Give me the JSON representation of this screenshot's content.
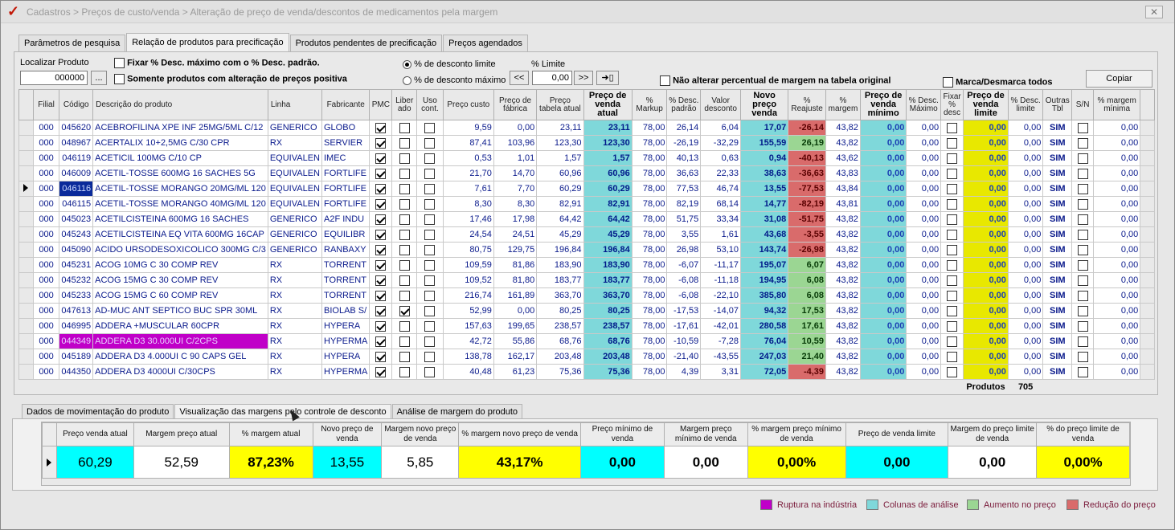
{
  "window": {
    "title": "Cadastros > Preços de custo/venda > Alteração de preço de venda/descontos de medicamentos pela margem",
    "close_label": "✕"
  },
  "tabs": [
    {
      "label": "Parâmetros de pesquisa"
    },
    {
      "label": "Relação de produtos para precificação"
    },
    {
      "label": "Produtos pendentes de precificação"
    },
    {
      "label": "Preços agendados"
    }
  ],
  "search": {
    "label": "Localizar Produto",
    "value": "000000",
    "browse_label": "...",
    "fix_desc_label": "Fixar % Desc. máximo com o % Desc. padrão.",
    "only_positive_label": "Somente produtos com alteração de preços positiva",
    "radio_limite_label": "% de desconto limite",
    "radio_maximo_label": "% de desconto máximo",
    "limit_label": "% Limite",
    "limit_value": "0,00",
    "prev_label": "<<",
    "next_label": ">>",
    "apply_label": "➜▯",
    "no_alter_label": "Não alterar percentual de margem na tabela original",
    "mark_all_label": "Marca/Desmarca todos",
    "copy_label": "Copiar"
  },
  "grid": {
    "headers": [
      "Filial",
      "Código",
      "Descrição do produto",
      "Linha",
      "Fabricante",
      "PMC",
      "Liber ado",
      "Uso cont.",
      "Preço custo",
      "Preço de fábrica",
      "Preço tabela atual",
      "Preço de venda atual",
      "% Markup",
      "% Desc. padrão",
      "Valor desconto",
      "Novo preço venda",
      "% Reajuste",
      "% margem",
      "Preço de venda mínimo",
      "% Desc. Máximo",
      "Fixar % desc",
      "Preço de venda limite",
      "% Desc. limite",
      "Outras Tbl",
      "S/N",
      "% margem mínima"
    ],
    "rows": [
      {
        "filial": "000",
        "codigo": "045620",
        "desc": "ACEBROFILINA XPE INF 25MG/5ML C/12",
        "linha": "GENERICO",
        "fab": "GLOBO",
        "pmc": true,
        "lib": false,
        "uso": false,
        "custo": "9,59",
        "fabrica": "0,00",
        "tabela": "23,11",
        "venda": "23,11",
        "markup": "78,00",
        "descp": "26,14",
        "valdesc": "6,04",
        "novo": "17,07",
        "reaj": "-26,14",
        "reajc": "red",
        "marg": "43,82",
        "minimo": "0,00",
        "descmax": "0,00",
        "fixar": false,
        "limite": "0,00",
        "desclim": "0,00",
        "outras": "SIM",
        "sn": false,
        "margmin": "0,00"
      },
      {
        "filial": "000",
        "codigo": "048967",
        "desc": "ACERTALIX 10+2,5MG C/30 CPR",
        "linha": "RX",
        "fab": "SERVIER",
        "pmc": true,
        "lib": false,
        "uso": false,
        "custo": "87,41",
        "fabrica": "103,96",
        "tabela": "123,30",
        "venda": "123,30",
        "markup": "78,00",
        "descp": "-26,19",
        "valdesc": "-32,29",
        "novo": "155,59",
        "reaj": "26,19",
        "reajc": "green",
        "marg": "43,82",
        "minimo": "0,00",
        "descmax": "0,00",
        "fixar": false,
        "limite": "0,00",
        "desclim": "0,00",
        "outras": "SIM",
        "sn": false,
        "margmin": "0,00"
      },
      {
        "filial": "000",
        "codigo": "046119",
        "desc": "ACETICIL 100MG C/10 CP",
        "linha": "EQUIVALEN",
        "fab": "IMEC",
        "pmc": true,
        "lib": false,
        "uso": false,
        "custo": "0,53",
        "fabrica": "1,01",
        "tabela": "1,57",
        "venda": "1,57",
        "markup": "78,00",
        "descp": "40,13",
        "valdesc": "0,63",
        "novo": "0,94",
        "reaj": "-40,13",
        "reajc": "red",
        "marg": "43,62",
        "minimo": "0,00",
        "descmax": "0,00",
        "fixar": false,
        "limite": "0,00",
        "desclim": "0,00",
        "outras": "SIM",
        "sn": false,
        "margmin": "0,00"
      },
      {
        "filial": "000",
        "codigo": "046009",
        "desc": "ACETIL-TOSSE 600MG 16 SACHES 5G",
        "linha": "EQUIVALEN",
        "fab": "FORTLIFE",
        "pmc": true,
        "lib": false,
        "uso": false,
        "custo": "21,70",
        "fabrica": "14,70",
        "tabela": "60,96",
        "venda": "60,96",
        "markup": "78,00",
        "descp": "36,63",
        "valdesc": "22,33",
        "novo": "38,63",
        "reaj": "-36,63",
        "reajc": "red",
        "marg": "43,83",
        "minimo": "0,00",
        "descmax": "0,00",
        "fixar": false,
        "limite": "0,00",
        "desclim": "0,00",
        "outras": "SIM",
        "sn": false,
        "margmin": "0,00"
      },
      {
        "filial": "000",
        "codigo": "046116",
        "desc": "ACETIL-TOSSE MORANGO 20MG/ML 120",
        "linha": "EQUIVALEN",
        "fab": "FORTLIFE",
        "pmc": true,
        "lib": false,
        "uso": false,
        "custo": "7,61",
        "fabrica": "7,70",
        "tabela": "60,29",
        "venda": "60,29",
        "markup": "78,00",
        "descp": "77,53",
        "valdesc": "46,74",
        "novo": "13,55",
        "reaj": "-77,53",
        "reajc": "red",
        "marg": "43,84",
        "minimo": "0,00",
        "descmax": "0,00",
        "fixar": false,
        "limite": "0,00",
        "desclim": "0,00",
        "outras": "SIM",
        "sn": false,
        "margmin": "0,00",
        "current": true,
        "selcode": true
      },
      {
        "filial": "000",
        "codigo": "046115",
        "desc": "ACETIL-TOSSE MORANGO 40MG/ML 120",
        "linha": "EQUIVALEN",
        "fab": "FORTLIFE",
        "pmc": true,
        "lib": false,
        "uso": false,
        "custo": "8,30",
        "fabrica": "8,30",
        "tabela": "82,91",
        "venda": "82,91",
        "markup": "78,00",
        "descp": "82,19",
        "valdesc": "68,14",
        "novo": "14,77",
        "reaj": "-82,19",
        "reajc": "red",
        "marg": "43,81",
        "minimo": "0,00",
        "descmax": "0,00",
        "fixar": false,
        "limite": "0,00",
        "desclim": "0,00",
        "outras": "SIM",
        "sn": false,
        "margmin": "0,00"
      },
      {
        "filial": "000",
        "codigo": "045023",
        "desc": "ACETILCISTEINA 600MG 16 SACHES",
        "linha": "GENERICO",
        "fab": "A2F INDU",
        "pmc": true,
        "lib": false,
        "uso": false,
        "custo": "17,46",
        "fabrica": "17,98",
        "tabela": "64,42",
        "venda": "64,42",
        "markup": "78,00",
        "descp": "51,75",
        "valdesc": "33,34",
        "novo": "31,08",
        "reaj": "-51,75",
        "reajc": "red",
        "marg": "43,82",
        "minimo": "0,00",
        "descmax": "0,00",
        "fixar": false,
        "limite": "0,00",
        "desclim": "0,00",
        "outras": "SIM",
        "sn": false,
        "margmin": "0,00"
      },
      {
        "filial": "000",
        "codigo": "045243",
        "desc": "ACETILCISTEINA EQ VITA 600MG 16CAP",
        "linha": "GENERICO",
        "fab": "EQUILIBR",
        "pmc": true,
        "lib": false,
        "uso": false,
        "custo": "24,54",
        "fabrica": "24,51",
        "tabela": "45,29",
        "venda": "45,29",
        "markup": "78,00",
        "descp": "3,55",
        "valdesc": "1,61",
        "novo": "43,68",
        "reaj": "-3,55",
        "reajc": "red",
        "marg": "43,82",
        "minimo": "0,00",
        "descmax": "0,00",
        "fixar": false,
        "limite": "0,00",
        "desclim": "0,00",
        "outras": "SIM",
        "sn": false,
        "margmin": "0,00"
      },
      {
        "filial": "000",
        "codigo": "045090",
        "desc": "ACIDO URSODESOXICOLICO 300MG C/3",
        "linha": "GENERICO",
        "fab": "RANBAXY",
        "pmc": true,
        "lib": false,
        "uso": false,
        "custo": "80,75",
        "fabrica": "129,75",
        "tabela": "196,84",
        "venda": "196,84",
        "markup": "78,00",
        "descp": "26,98",
        "valdesc": "53,10",
        "novo": "143,74",
        "reaj": "-26,98",
        "reajc": "red",
        "marg": "43,82",
        "minimo": "0,00",
        "descmax": "0,00",
        "fixar": false,
        "limite": "0,00",
        "desclim": "0,00",
        "outras": "SIM",
        "sn": false,
        "margmin": "0,00"
      },
      {
        "filial": "000",
        "codigo": "045231",
        "desc": "ACOG 10MG C 30 COMP REV",
        "linha": "RX",
        "fab": "TORRENT",
        "pmc": true,
        "lib": false,
        "uso": false,
        "custo": "109,59",
        "fabrica": "81,86",
        "tabela": "183,90",
        "venda": "183,90",
        "markup": "78,00",
        "descp": "-6,07",
        "valdesc": "-11,17",
        "novo": "195,07",
        "reaj": "6,07",
        "reajc": "green",
        "marg": "43,82",
        "minimo": "0,00",
        "descmax": "0,00",
        "fixar": false,
        "limite": "0,00",
        "desclim": "0,00",
        "outras": "SIM",
        "sn": false,
        "margmin": "0,00"
      },
      {
        "filial": "000",
        "codigo": "045232",
        "desc": "ACOG 15MG C 30 COMP REV",
        "linha": "RX",
        "fab": "TORRENT",
        "pmc": true,
        "lib": false,
        "uso": false,
        "custo": "109,52",
        "fabrica": "81,80",
        "tabela": "183,77",
        "venda": "183,77",
        "markup": "78,00",
        "descp": "-6,08",
        "valdesc": "-11,18",
        "novo": "194,95",
        "reaj": "6,08",
        "reajc": "green",
        "marg": "43,82",
        "minimo": "0,00",
        "descmax": "0,00",
        "fixar": false,
        "limite": "0,00",
        "desclim": "0,00",
        "outras": "SIM",
        "sn": false,
        "margmin": "0,00"
      },
      {
        "filial": "000",
        "codigo": "045233",
        "desc": "ACOG 15MG C 60 COMP REV",
        "linha": "RX",
        "fab": "TORRENT",
        "pmc": true,
        "lib": false,
        "uso": false,
        "custo": "216,74",
        "fabrica": "161,89",
        "tabela": "363,70",
        "venda": "363,70",
        "markup": "78,00",
        "descp": "-6,08",
        "valdesc": "-22,10",
        "novo": "385,80",
        "reaj": "6,08",
        "reajc": "green",
        "marg": "43,82",
        "minimo": "0,00",
        "descmax": "0,00",
        "fixar": false,
        "limite": "0,00",
        "desclim": "0,00",
        "outras": "SIM",
        "sn": false,
        "margmin": "0,00"
      },
      {
        "filial": "000",
        "codigo": "047613",
        "desc": "AD-MUC ANT SEPTICO BUC SPR 30ML",
        "linha": "RX",
        "fab": "BIOLAB S/",
        "pmc": true,
        "lib": true,
        "uso": false,
        "custo": "52,99",
        "fabrica": "0,00",
        "tabela": "80,25",
        "venda": "80,25",
        "markup": "78,00",
        "descp": "-17,53",
        "valdesc": "-14,07",
        "novo": "94,32",
        "reaj": "17,53",
        "reajc": "green",
        "marg": "43,82",
        "minimo": "0,00",
        "descmax": "0,00",
        "fixar": false,
        "limite": "0,00",
        "desclim": "0,00",
        "outras": "SIM",
        "sn": false,
        "margmin": "0,00"
      },
      {
        "filial": "000",
        "codigo": "046995",
        "desc": "ADDERA +MUSCULAR 60CPR",
        "linha": "RX",
        "fab": "HYPERA",
        "pmc": true,
        "lib": false,
        "uso": false,
        "custo": "157,63",
        "fabrica": "199,65",
        "tabela": "238,57",
        "venda": "238,57",
        "markup": "78,00",
        "descp": "-17,61",
        "valdesc": "-42,01",
        "novo": "280,58",
        "reaj": "17,61",
        "reajc": "green",
        "marg": "43,82",
        "minimo": "0,00",
        "descmax": "0,00",
        "fixar": false,
        "limite": "0,00",
        "desclim": "0,00",
        "outras": "SIM",
        "sn": false,
        "margmin": "0,00"
      },
      {
        "filial": "000",
        "codigo": "044349",
        "desc": "ADDERA D3 30.000UI C/2CPS",
        "linha": "RX",
        "fab": "HYPERMA",
        "pmc": true,
        "lib": false,
        "uso": false,
        "custo": "42,72",
        "fabrica": "55,86",
        "tabela": "68,76",
        "venda": "68,76",
        "markup": "78,00",
        "descp": "-10,59",
        "valdesc": "-7,28",
        "novo": "76,04",
        "reaj": "10,59",
        "reajc": "green",
        "marg": "43,82",
        "minimo": "0,00",
        "descmax": "0,00",
        "fixar": false,
        "limite": "0,00",
        "desclim": "0,00",
        "outras": "SIM",
        "sn": false,
        "margmin": "0,00",
        "rupture": true
      },
      {
        "filial": "000",
        "codigo": "045189",
        "desc": "ADDERA D3 4.000UI C 90 CAPS GEL",
        "linha": "RX",
        "fab": "HYPERA",
        "pmc": true,
        "lib": false,
        "uso": false,
        "custo": "138,78",
        "fabrica": "162,17",
        "tabela": "203,48",
        "venda": "203,48",
        "markup": "78,00",
        "descp": "-21,40",
        "valdesc": "-43,55",
        "novo": "247,03",
        "reaj": "21,40",
        "reajc": "green",
        "marg": "43,82",
        "minimo": "0,00",
        "descmax": "0,00",
        "fixar": false,
        "limite": "0,00",
        "desclim": "0,00",
        "outras": "SIM",
        "sn": false,
        "margmin": "0,00"
      },
      {
        "filial": "000",
        "codigo": "044350",
        "desc": "ADDERA D3 4000UI C/30CPS",
        "linha": "RX",
        "fab": "HYPERMA",
        "pmc": true,
        "lib": false,
        "uso": false,
        "custo": "40,48",
        "fabrica": "61,23",
        "tabela": "75,36",
        "venda": "75,36",
        "markup": "78,00",
        "descp": "4,39",
        "valdesc": "3,31",
        "novo": "72,05",
        "reaj": "-4,39",
        "reajc": "red",
        "marg": "43,82",
        "minimo": "0,00",
        "descmax": "0,00",
        "fixar": false,
        "limite": "0,00",
        "desclim": "0,00",
        "outras": "SIM",
        "sn": false,
        "margmin": "0,00"
      }
    ],
    "footer_label": "Produtos",
    "footer_count": "705"
  },
  "bottom_tabs": [
    {
      "label": "Dados de movimentação do produto"
    },
    {
      "label": "Visualização das margens pelo controle de desconto"
    },
    {
      "label": "Análise de margem do produto"
    }
  ],
  "margins": {
    "headers": [
      "Preço venda atual",
      "Margem preço atual",
      "% margem atual",
      "Novo preço de venda",
      "Margem novo preço de venda",
      "% margem novo preço de venda",
      "Preço mínimo de venda",
      "Margem preço mínimo de venda",
      "% margem preço mínimo de venda",
      "Preço de venda limite",
      "Margem do preço limite de venda",
      "% do preço limite de venda"
    ],
    "values": [
      "60,29",
      "52,59",
      "87,23%",
      "13,55",
      "5,85",
      "43,17%",
      "0,00",
      "0,00",
      "0,00%",
      "0,00",
      "0,00",
      "0,00%"
    ]
  },
  "legend": [
    {
      "label": "Ruptura na indústria",
      "color": "#c000c8"
    },
    {
      "label": "Colunas de análise",
      "color": "#7fd8da"
    },
    {
      "label": "Aumento no preço",
      "color": "#9bd693"
    },
    {
      "label": "Redução do preço",
      "color": "#d96b6b"
    }
  ]
}
